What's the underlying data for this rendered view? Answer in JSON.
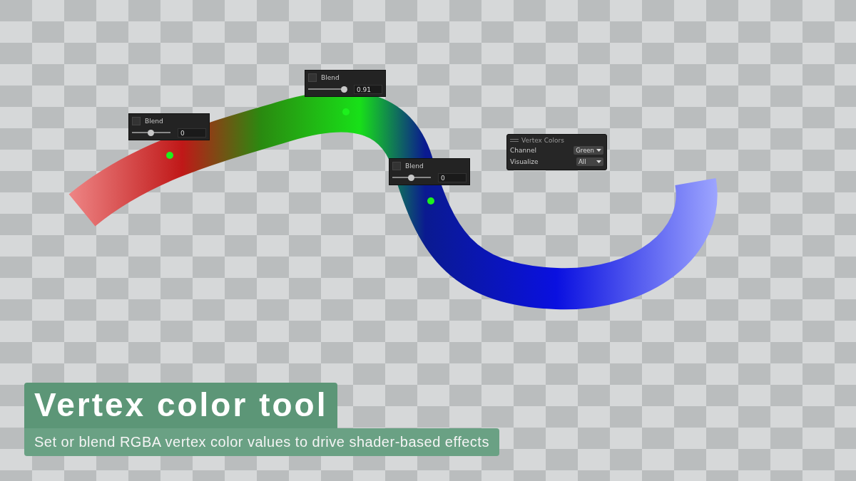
{
  "blend_handles": [
    {
      "label": "Blend",
      "checked": false,
      "level": 0.5,
      "value": "0"
    },
    {
      "label": "Blend",
      "checked": false,
      "level": 0.95,
      "value": "0.91"
    },
    {
      "label": "Blend",
      "checked": false,
      "level": 0.5,
      "value": "0"
    }
  ],
  "vertex_colors_overlay": {
    "title": "Vertex Colors",
    "fields": [
      {
        "label": "Channel",
        "value": "Green"
      },
      {
        "label": "Visualize",
        "value": "All"
      }
    ]
  },
  "caption": {
    "title": "Vertex color tool",
    "subtitle": "Set or blend RGBA vertex color values to drive shader-based effects"
  }
}
